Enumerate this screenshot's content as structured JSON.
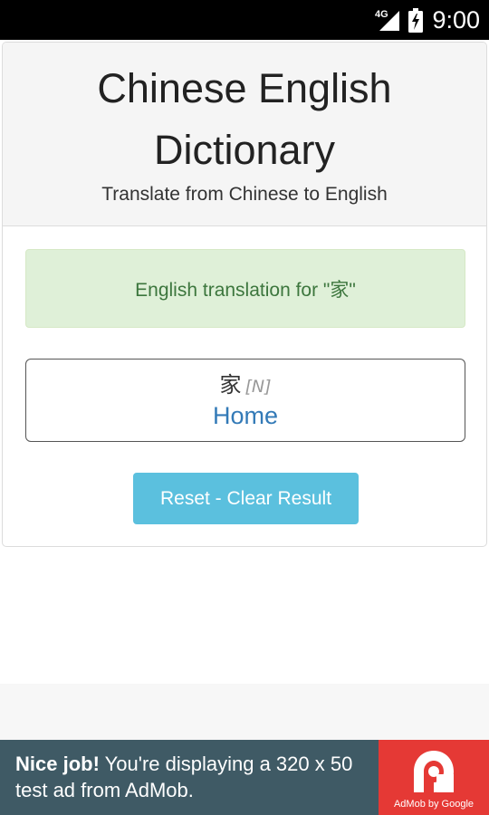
{
  "status_bar": {
    "network": "4G",
    "time": "9:00"
  },
  "header": {
    "title_line1": "Chinese English",
    "title_line2": "Dictionary",
    "subtitle": "Translate from Chinese to English"
  },
  "alert": {
    "text": "English translation for \"家\""
  },
  "result": {
    "word": "家",
    "pos": "[N]",
    "translation": "Home"
  },
  "reset_button": {
    "label": "Reset - Clear Result"
  },
  "ad": {
    "bold": "Nice job!",
    "text": " You're displaying a 320 x 50 test ad from AdMob.",
    "logo_caption": "AdMob by Google"
  },
  "colors": {
    "alert_bg": "#dff0d8",
    "alert_text": "#3c763d",
    "link_blue": "#337ab7",
    "button_bg": "#5bc0de",
    "ad_bg": "#3f5a65",
    "ad_logo_bg": "#e53935"
  },
  "icons": [
    "signal-4g-icon",
    "battery-charging-icon",
    "admob-logo-icon"
  ]
}
